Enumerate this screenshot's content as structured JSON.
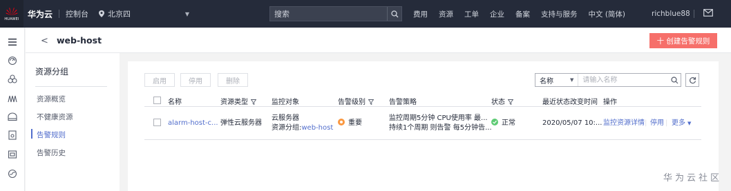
{
  "topbar": {
    "logo_text": "HUAWEI",
    "brand": "华为云",
    "console": "控制台",
    "region": "北京四",
    "search_placeholder": "搜索",
    "nav": [
      "费用",
      "资源",
      "工单",
      "企业",
      "备案",
      "支持与服务",
      "中文 (简体)"
    ],
    "user": "richblue88"
  },
  "header": {
    "title": "web-host",
    "create_button": "十 创建告警规则"
  },
  "group_panel": {
    "title": "资源分组",
    "items": [
      "资源概览",
      "不健康资源",
      "告警规则",
      "告警历史"
    ],
    "active_index": 2
  },
  "toolbar": {
    "enable": "启用",
    "disable": "停用",
    "delete": "删除",
    "filter_field": "名称",
    "filter_placeholder": "请输入名称"
  },
  "table": {
    "columns": [
      "名称",
      "资源类型",
      "监控对象",
      "告警级别",
      "告警策略",
      "状态",
      "最近状态改变时间",
      "操作"
    ],
    "rows": [
      {
        "name": "alarm-host-c...",
        "resource_type": "弹性云服务器",
        "monitor_line1": "云服务器",
        "monitor_line2_prefix": "资源分组:",
        "monitor_line2_link": "web-host",
        "level": "重要",
        "policy_line1": "监控周期5分钟 CPU使用率 最...",
        "policy_line2": "持续1个周期 则告警 每5分钟告...",
        "status": "正常",
        "changed": "2020/05/07 10:...",
        "ops": [
          "监控资源详情",
          "停用",
          "更多"
        ]
      }
    ]
  },
  "watermark": "华为云社区",
  "colors": {
    "accent": "#526ecc",
    "danger": "#f66f6a",
    "important": "#fa9841",
    "ok": "#5ecb74",
    "topbar": "#252b3a"
  }
}
